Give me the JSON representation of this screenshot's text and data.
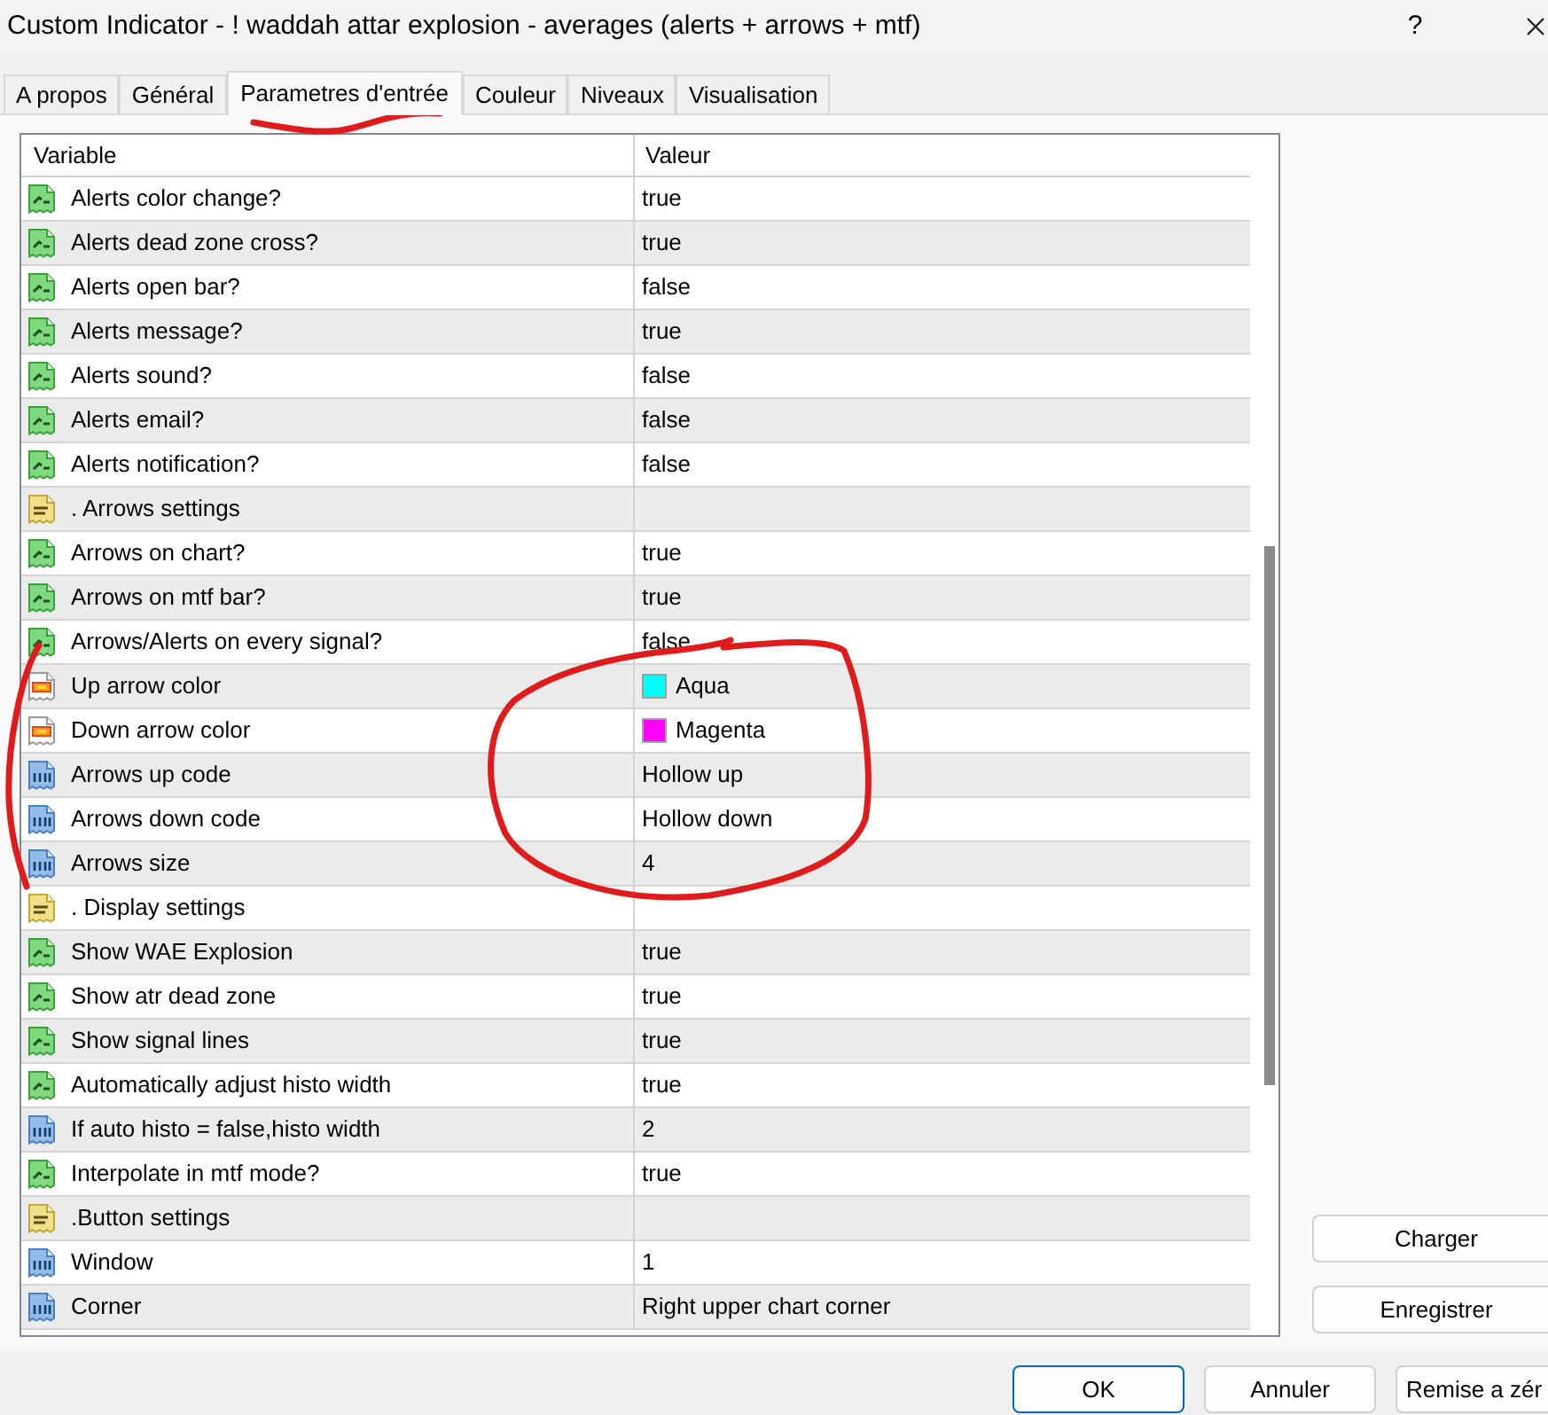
{
  "window": {
    "title": "Custom Indicator - ! waddah attar explosion - averages (alerts + arrows + mtf)",
    "help": "?"
  },
  "tabs": [
    {
      "label": "A propos",
      "selected": false
    },
    {
      "label": "Général",
      "selected": false
    },
    {
      "label": "Parametres d'entrée",
      "selected": true
    },
    {
      "label": "Couleur",
      "selected": false
    },
    {
      "label": "Niveaux",
      "selected": false
    },
    {
      "label": "Visualisation",
      "selected": false
    }
  ],
  "table": {
    "columns": [
      "Variable",
      "Valeur"
    ],
    "rows": [
      {
        "kind": "bool",
        "variable": "Alerts color change?",
        "value": "true"
      },
      {
        "kind": "bool",
        "variable": "Alerts dead zone cross?",
        "value": "true"
      },
      {
        "kind": "bool",
        "variable": "Alerts open bar?",
        "value": "false"
      },
      {
        "kind": "bool",
        "variable": "Alerts message?",
        "value": "true"
      },
      {
        "kind": "bool",
        "variable": "Alerts sound?",
        "value": "false"
      },
      {
        "kind": "bool",
        "variable": "Alerts email?",
        "value": "false"
      },
      {
        "kind": "bool",
        "variable": "Alerts notification?",
        "value": "false"
      },
      {
        "kind": "string",
        "variable": ". Arrows settings"
      },
      {
        "kind": "bool",
        "variable": "Arrows on chart?",
        "value": "true"
      },
      {
        "kind": "bool",
        "variable": "Arrows on mtf bar?",
        "value": "true"
      },
      {
        "kind": "bool",
        "variable": "Arrows/Alerts on every signal?",
        "value": "false"
      },
      {
        "kind": "color",
        "variable": "Up arrow color",
        "value": "Aqua",
        "color": "#00ffff"
      },
      {
        "kind": "color",
        "variable": "Down arrow color",
        "value": "Magenta",
        "color": "#ff00ff"
      },
      {
        "kind": "int",
        "variable": "Arrows up code",
        "value": "Hollow up"
      },
      {
        "kind": "int",
        "variable": "Arrows down code",
        "value": "Hollow down"
      },
      {
        "kind": "int",
        "variable": "Arrows size",
        "value": "4"
      },
      {
        "kind": "string",
        "variable": ". Display settings"
      },
      {
        "kind": "bool",
        "variable": "Show WAE Explosion",
        "value": "true"
      },
      {
        "kind": "bool",
        "variable": "Show atr dead zone",
        "value": "true"
      },
      {
        "kind": "bool",
        "variable": "Show signal lines",
        "value": "true"
      },
      {
        "kind": "bool",
        "variable": "Automatically adjust histo width",
        "value": "true"
      },
      {
        "kind": "int",
        "variable": "If auto histo = false,histo width",
        "value": "2"
      },
      {
        "kind": "bool",
        "variable": "Interpolate in mtf mode?",
        "value": "true"
      },
      {
        "kind": "string",
        "variable": ".Button settings"
      },
      {
        "kind": "int",
        "variable": "Window",
        "value": "1"
      },
      {
        "kind": "int",
        "variable": "Corner",
        "value": "Right upper chart corner"
      }
    ]
  },
  "side_buttons": [
    {
      "label": "Charger"
    },
    {
      "label": "Enregistrer"
    }
  ],
  "footer_buttons": [
    {
      "label": "OK",
      "default": true
    },
    {
      "label": "Annuler",
      "default": false
    },
    {
      "label": "Remise a zér",
      "default": false
    }
  ],
  "annotations": [
    {
      "kind": "underline"
    },
    {
      "kind": "bracket"
    },
    {
      "kind": "circle"
    }
  ]
}
